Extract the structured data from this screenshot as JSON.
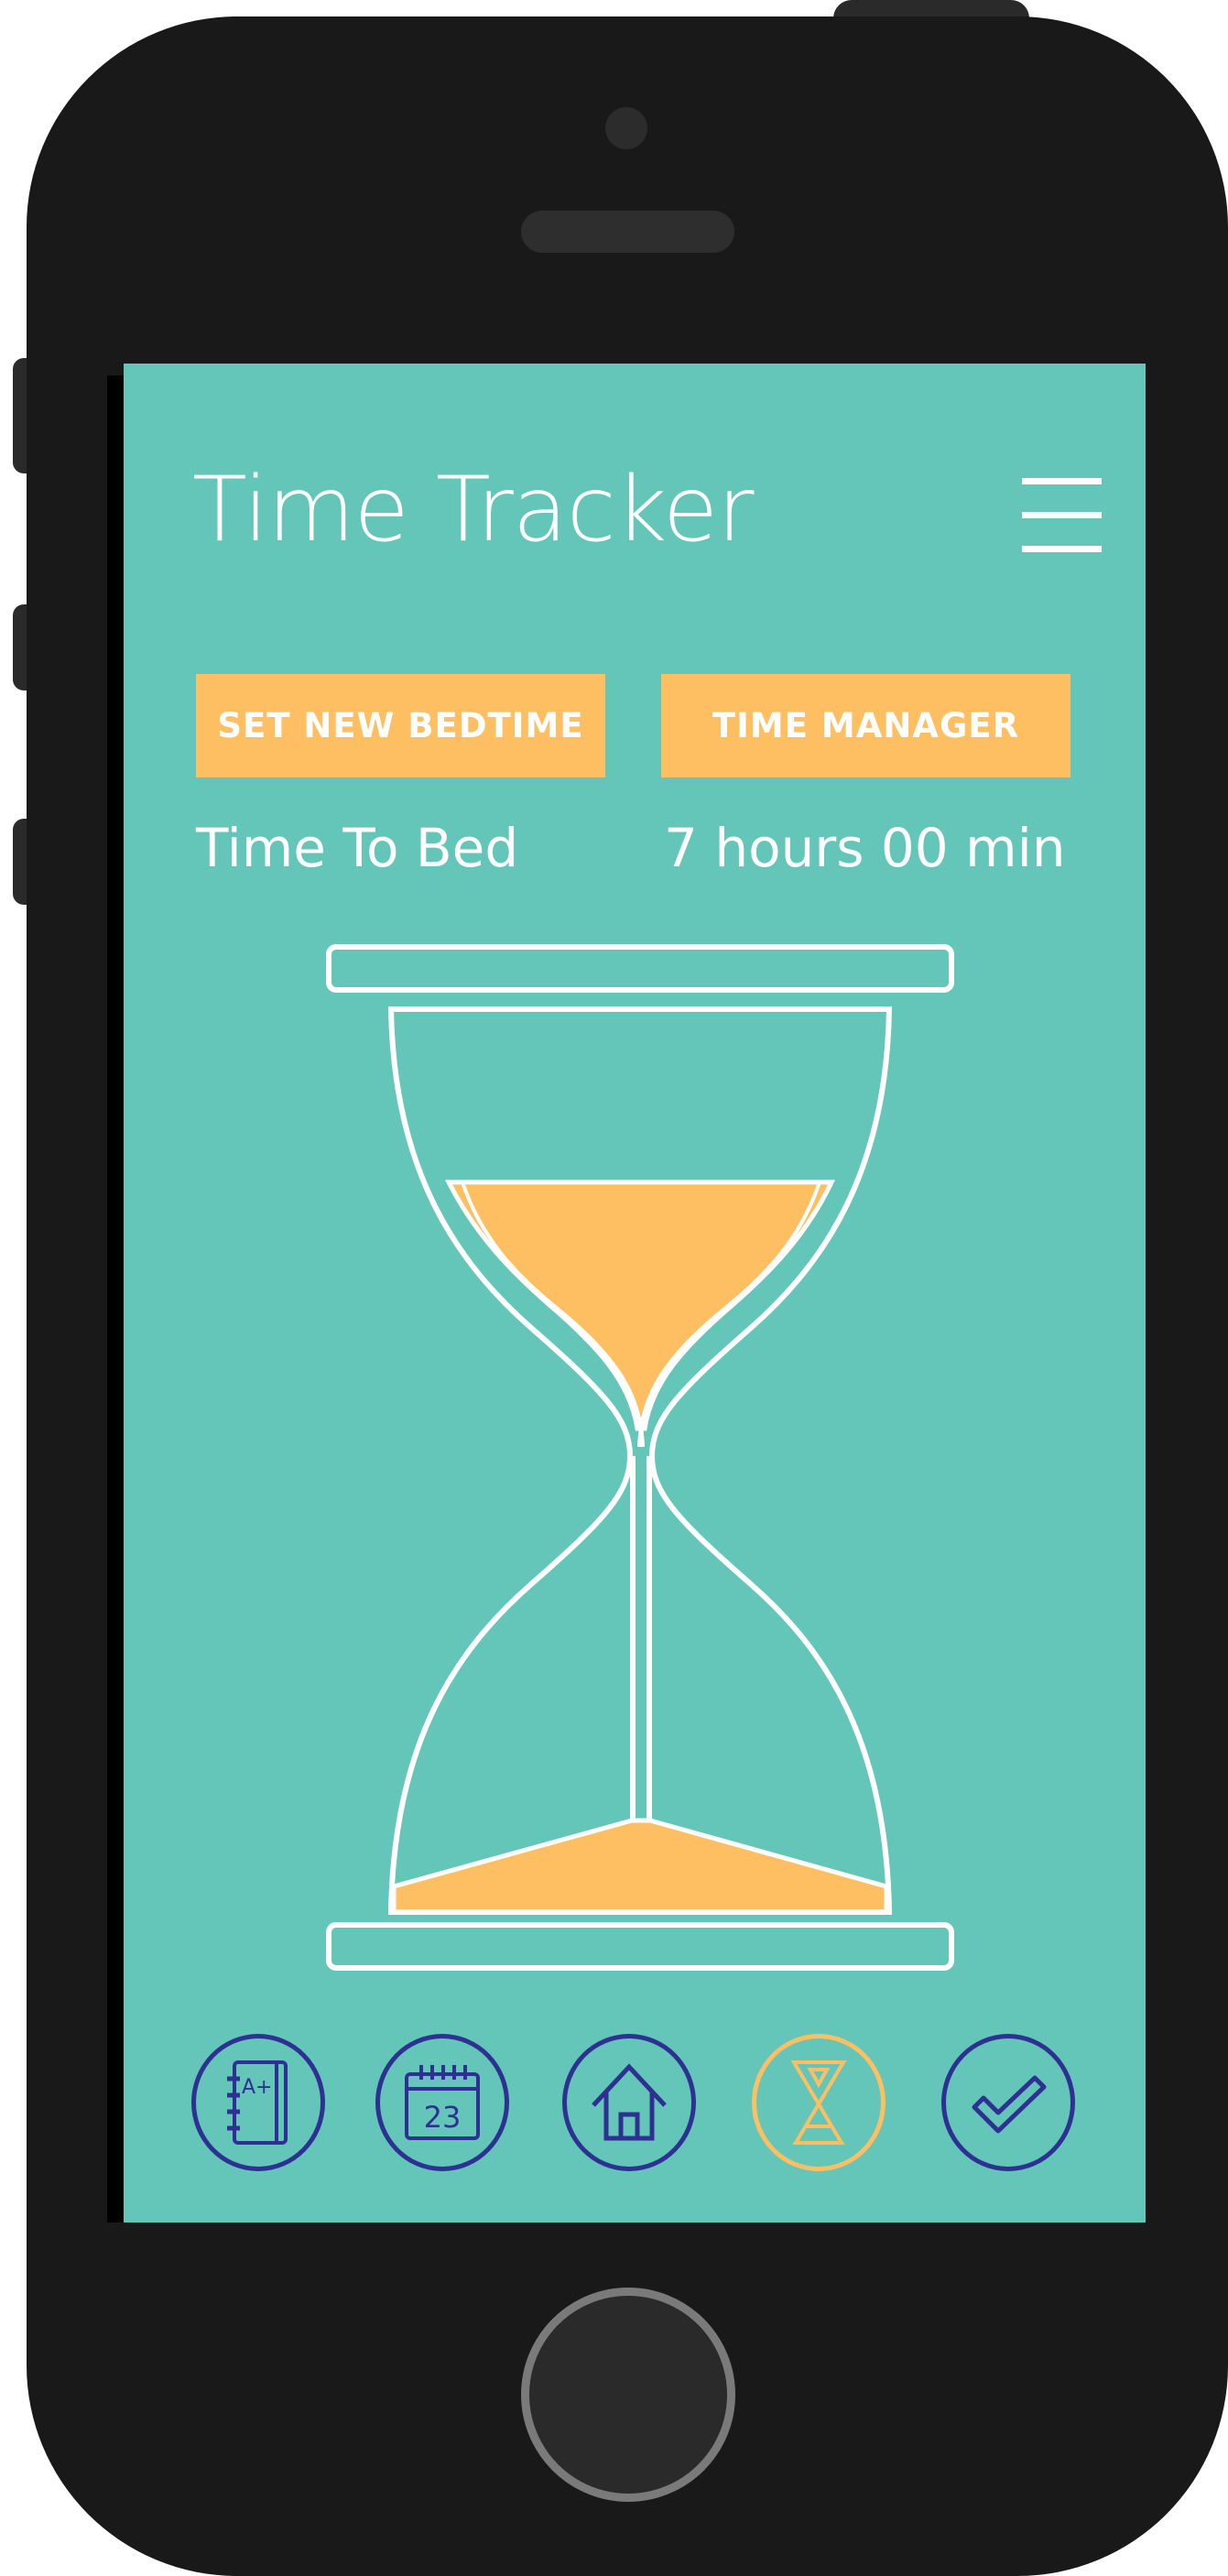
{
  "app": {
    "title": "Time Tracker"
  },
  "actions": {
    "set_bedtime_label": "SET NEW BEDTIME",
    "time_manager_label": "TIME MANAGER"
  },
  "status": {
    "label": "Time To Bed",
    "value": "7 hours 00 min"
  },
  "hourglass": {
    "top_sand_fraction": 0.6
  },
  "bottom_nav": {
    "items": [
      {
        "name": "grades-notebook",
        "icon": "notebook-icon",
        "badge_text": "A+"
      },
      {
        "name": "calendar",
        "icon": "calendar-icon",
        "day": "23"
      },
      {
        "name": "home",
        "icon": "home-icon"
      },
      {
        "name": "time-tracker",
        "icon": "hourglass-icon",
        "active": true
      },
      {
        "name": "tasks",
        "icon": "checkmark-icon"
      }
    ]
  },
  "colors": {
    "screen_bg": "#63c6b9",
    "accent": "#fdbf62",
    "nav_icon": "#2e3192",
    "phone_body": "#191919"
  }
}
